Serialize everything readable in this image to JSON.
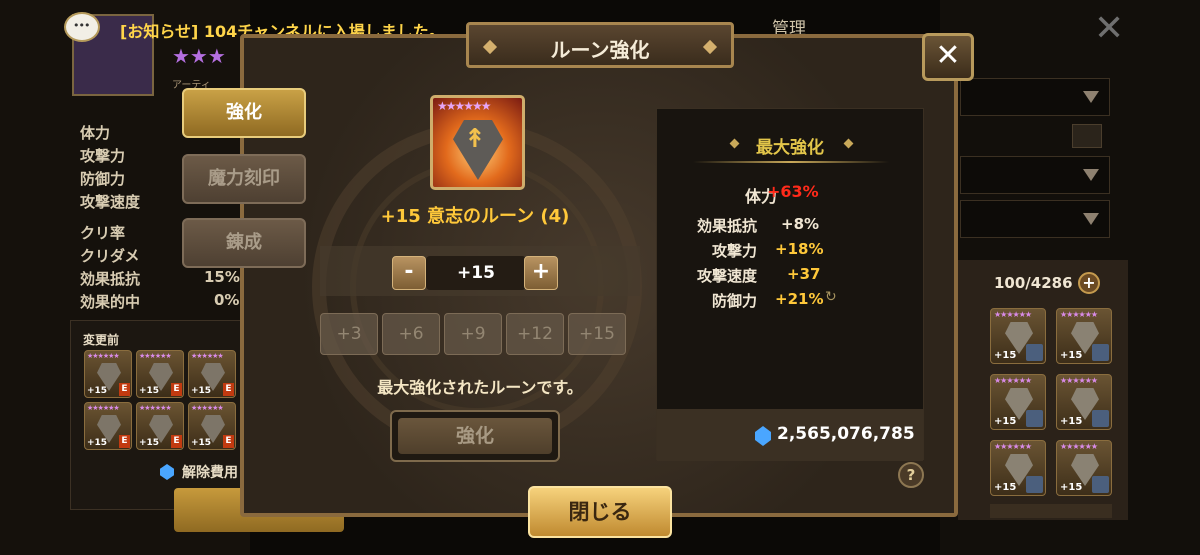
{
  "notice": {
    "text": "[お知らせ] 104チャンネルに入場しました。"
  },
  "header": {
    "title": "ルーン強化",
    "bg_label": "管理"
  },
  "tabs": [
    {
      "label": "強化",
      "active": true
    },
    {
      "label": "魔力刻印",
      "active": false
    },
    {
      "label": "錬成",
      "active": false
    }
  ],
  "rune": {
    "stars": "★★★★★★",
    "name": "+15 意志のルーン (4)"
  },
  "level": {
    "minus": "-",
    "value": "+15",
    "plus": "+"
  },
  "quick_levels": [
    "+3",
    "+6",
    "+9",
    "+12",
    "+15"
  ],
  "max_message": "最大強化されたルーンです。",
  "enhance_label": "強化",
  "stats": {
    "title": "最大強化",
    "main": {
      "label": "体力",
      "value": "+63%"
    },
    "subs": [
      {
        "label": "効果抵抗",
        "value": "+8%"
      },
      {
        "label": "攻撃力",
        "value": "+18%"
      },
      {
        "label": "攻撃速度",
        "value": "+37"
      },
      {
        "label": "防御力",
        "value": "+21%"
      }
    ],
    "crystals": "2,565,076,785"
  },
  "help": "?",
  "close_label": "閉じる",
  "background": {
    "stat_labels": [
      "体力",
      "攻撃力",
      "防御力",
      "攻撃速度",
      "クリ率",
      "クリダメ",
      "効果抵抗",
      "効果的中"
    ],
    "stat_values": [
      "15%",
      "0%"
    ],
    "before_label": "変更前",
    "cost_label": "解除費用",
    "inventory_count": "100/4286",
    "rune_plus": "+15",
    "rune_grade": "E",
    "attr_label": "アーティ"
  },
  "colors": {
    "accent_gold": "#ffc83a",
    "main_stat_red": "#ff2a1a",
    "sub_value": "#ffc83a"
  }
}
